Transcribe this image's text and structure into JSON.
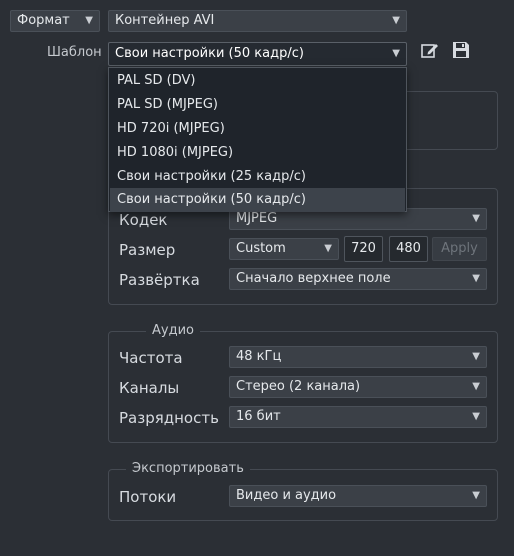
{
  "top": {
    "format_label": "Формат",
    "container_value": "Контейнер AVI",
    "template_label": "Шаблон",
    "template_value": "Свои настройки (50 кадр/с)"
  },
  "template_dropdown": {
    "options": [
      "PAL SD (DV)",
      "PAL SD (MJPEG)",
      "HD 720i (MJPEG)",
      "HD 1080i (MJPEG)",
      "Свои настройки (25 кадр/с)",
      "Свои настройки (50 кадр/с)"
    ],
    "selected_index": 5
  },
  "video": {
    "codec_label": "Кодек",
    "codec_value": "MJPEG",
    "size_label": "Размер",
    "size_value": "Custom",
    "width": "720",
    "height": "480",
    "apply_label": "Apply",
    "scan_label": "Развёртка",
    "scan_value": "Сначало верхнее поле"
  },
  "audio": {
    "legend": "Аудио",
    "freq_label": "Частота",
    "freq_value": "48 кГц",
    "channels_label": "Каналы",
    "channels_value": "Стерео (2 канала)",
    "depth_label": "Разрядность",
    "depth_value": "16 бит"
  },
  "export": {
    "legend": "Экспортировать",
    "streams_label": "Потоки",
    "streams_value": "Видео и аудио"
  },
  "icons": {
    "edit": "edit-icon",
    "save": "save-icon",
    "dropdown_arrow": "chevron-down-icon"
  }
}
